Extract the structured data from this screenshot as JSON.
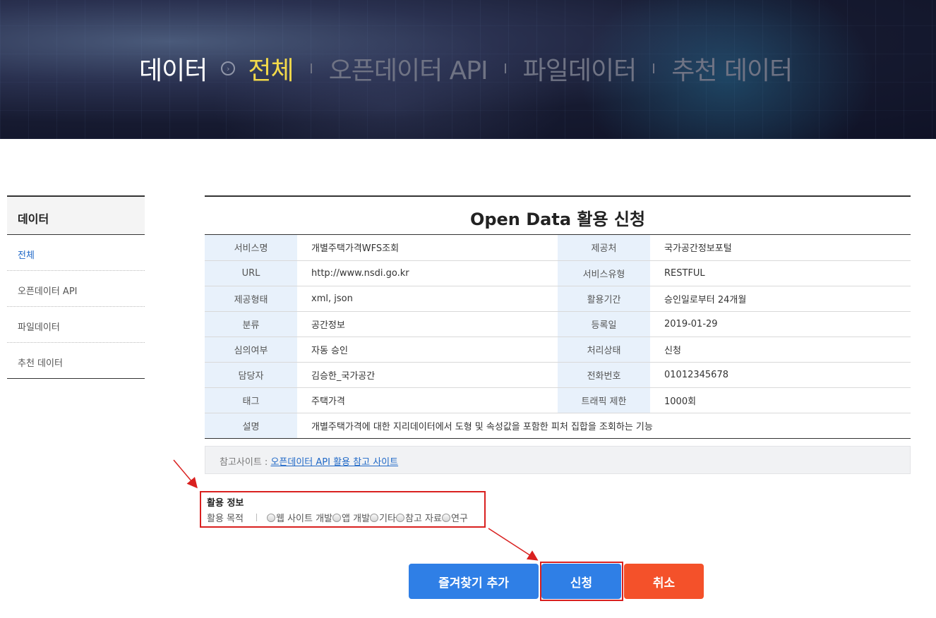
{
  "nav": {
    "root": "데이터",
    "items": [
      "전체",
      "오픈데이터 API",
      "파일데이터",
      "추천 데이터"
    ]
  },
  "sidebar": {
    "title": "데이터",
    "items": [
      "전체",
      "오픈데이터 API",
      "파일데이터",
      "추천 데이터"
    ]
  },
  "main": {
    "title": "Open Data 활용 신청",
    "rows": [
      {
        "l1": "서비스명",
        "v1": "개별주택가격WFS조회",
        "l2": "제공처",
        "v2": "국가공간정보포털"
      },
      {
        "l1": "URL",
        "v1": "http://www.nsdi.go.kr",
        "l2": "서비스유형",
        "v2": "RESTFUL"
      },
      {
        "l1": "제공형태",
        "v1": "xml, json",
        "l2": "활용기간",
        "v2": "승인일로부터 24개월"
      },
      {
        "l1": "분류",
        "v1": "공간정보",
        "l2": "등록일",
        "v2": "2019-01-29"
      },
      {
        "l1": "심의여부",
        "v1": "자동 승인",
        "l2": "처리상태",
        "v2": "신청"
      },
      {
        "l1": "담당자",
        "v1": "김승한_국가공간",
        "l2": "전화번호",
        "v2": "01012345678"
      },
      {
        "l1": "태그",
        "v1": "주택가격",
        "l2": "트래픽 제한",
        "v2": "1000회"
      }
    ],
    "desc_label": "설명",
    "desc_value": "개별주택가격에 대한 지리데이터에서 도형 및 속성값을 포함한 피처 집합을 조회하는 기능",
    "ref_label": "참고사이트 :",
    "ref_link": "오픈데이터 API 활용 참고 사이트"
  },
  "usage": {
    "title": "활용 정보",
    "purpose_label": "활용 목적",
    "options": [
      "웹 사이트 개발",
      "앱 개발",
      "기타",
      "참고 자료",
      "연구"
    ]
  },
  "buttons": {
    "favorite": "즐겨찾기 추가",
    "apply": "신청",
    "cancel": "취소"
  },
  "colors": {
    "primary": "#2f7fe6",
    "cancel": "#f4512a",
    "highlight": "#d9201f",
    "active_nav": "#f2d94a"
  }
}
